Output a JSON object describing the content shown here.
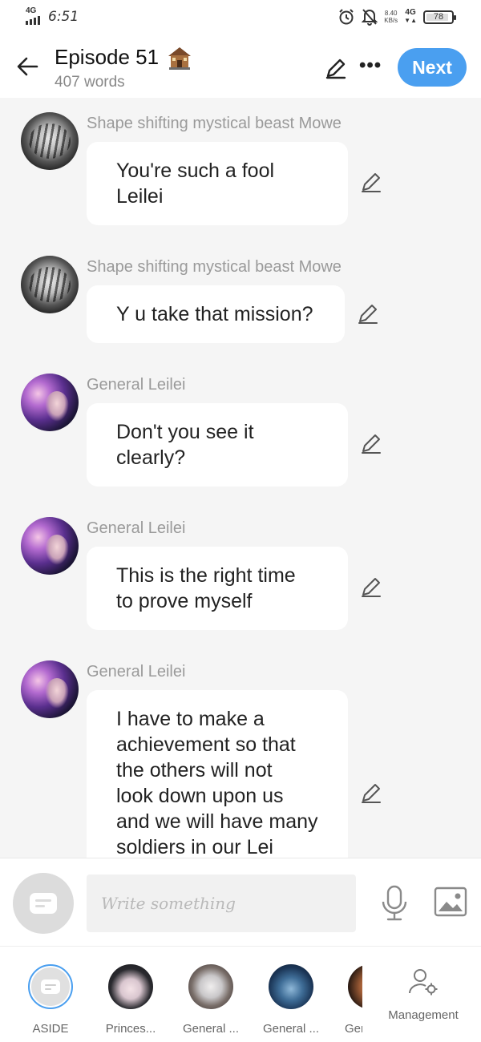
{
  "status_bar": {
    "network_label": "4G",
    "time": "6:51",
    "speed": "8.40",
    "speed_unit": "KB/s",
    "data_label": "4G",
    "battery": "78"
  },
  "header": {
    "title": "Episode 51",
    "subtitle": "407 words",
    "next_label": "Next"
  },
  "messages": [
    {
      "sender": "Shape shifting mystical beast Mowe",
      "avatar": "tiger",
      "lines": [
        "You're such a fool",
        "Leilei"
      ]
    },
    {
      "sender": "Shape shifting mystical beast Mowe",
      "avatar": "tiger",
      "lines": [
        "Y u take that mission?"
      ]
    },
    {
      "sender": "General Leilei",
      "avatar": "leilei",
      "lines": [
        "Don't you see it",
        "clearly?"
      ]
    },
    {
      "sender": "General Leilei",
      "avatar": "leilei",
      "lines": [
        "This is the right time",
        "to prove myself"
      ]
    },
    {
      "sender": "General Leilei",
      "avatar": "leilei",
      "lines": [
        "I have to make a",
        "achievement so that",
        "the others will not",
        "look down upon us",
        "and we will have many",
        "soldiers in our Lei"
      ]
    }
  ],
  "composer": {
    "placeholder": "Write something"
  },
  "characters": [
    {
      "label": "ASIDE"
    },
    {
      "label": "Princes..."
    },
    {
      "label": "General ..."
    },
    {
      "label": "General ..."
    },
    {
      "label": "Ger"
    }
  ],
  "management_label": "Management",
  "colors": {
    "accent": "#4a9ff0",
    "background": "#f5f5f5",
    "bubble": "#ffffff",
    "sender_text": "#9a9a9a"
  },
  "icons": {
    "back": "arrow-left-icon",
    "edit": "pencil-icon",
    "more": "more-horizontal-icon",
    "aside": "aside-bubble-icon",
    "mic": "microphone-icon",
    "image": "image-icon",
    "management": "user-gear-icon"
  }
}
